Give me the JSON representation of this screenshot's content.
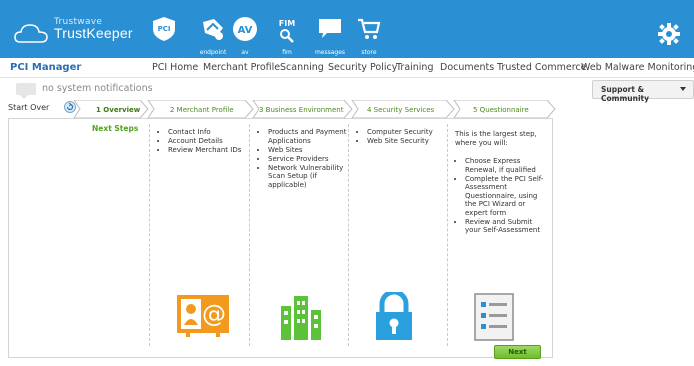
{
  "header": {
    "brand_line1": "Trustwave",
    "brand_line2": "TrustKeeper",
    "nav": [
      {
        "label": "",
        "icon": "pci-shield-icon"
      },
      {
        "label": "endpoint",
        "icon": "endpoint-icon"
      },
      {
        "label": "av",
        "icon": "av-icon"
      },
      {
        "label": "fim",
        "icon": "fim-icon"
      },
      {
        "label": "messages",
        "icon": "messages-icon"
      },
      {
        "label": "store",
        "icon": "store-cart-icon"
      }
    ],
    "pci_badge": "PCI",
    "av_badge": "AV",
    "fim_badge": "FIM",
    "settings_icon": "gear-icon",
    "accent": "#2a8fd3"
  },
  "menubar": {
    "title": "PCI Manager",
    "items": [
      "PCI Home",
      "Merchant Profile",
      "Scanning",
      "Security Policy",
      "Training",
      "Documents",
      "Trusted Commerce",
      "Web Malware Monitoring"
    ]
  },
  "notifications": {
    "text": "no system notifications",
    "support_label": "Support & Community"
  },
  "steps": {
    "start_over": "Start Over",
    "items": [
      "1 Overview",
      "2 Merchant Profile",
      "3 Business Environment",
      "4 Security Services",
      "5 Questionnaire"
    ],
    "active_index": 0
  },
  "main": {
    "next_steps_title": "Next Steps",
    "col1": [
      "Contact Info",
      "Account Details",
      "Review Merchant IDs"
    ],
    "col2": [
      "Products and Payment Applications",
      "Web Sites",
      "Service Providers",
      "Network Vulnerability Scan Setup (if applicable)"
    ],
    "col3": [
      "Computer Security",
      "Web Site Security"
    ],
    "intro": "This is the largest step, where you will:",
    "col4": [
      "Choose Express Renewal, if qualified",
      "Complete the PCI Self-Assessment Questionnaire, using the PCI Wizard or expert form",
      "Review and Submit your Self-Assessment"
    ],
    "next_label": "Next"
  }
}
